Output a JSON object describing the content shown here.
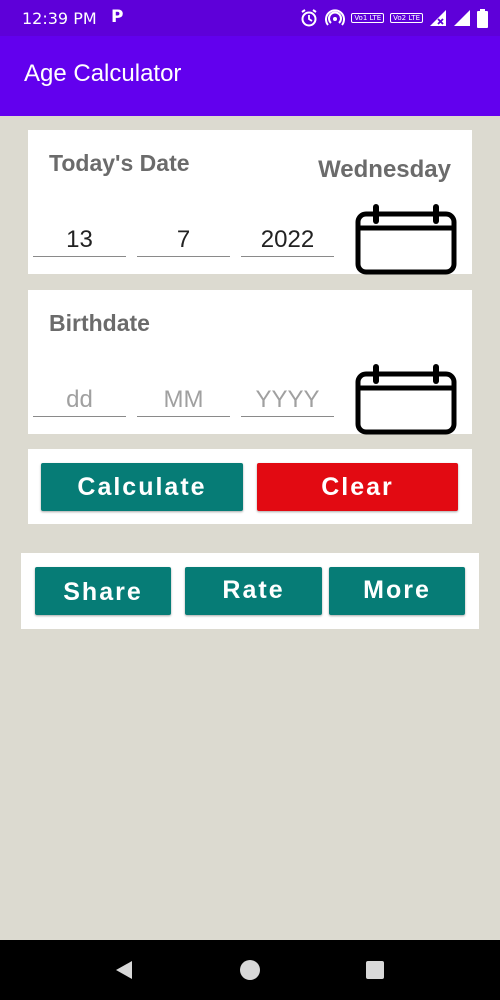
{
  "status_bar": {
    "time": "12:39 PM",
    "app_badge": "P",
    "icons": [
      "alarm-icon",
      "hotspot-icon",
      "volte-1-icon",
      "volte-2-icon",
      "signal-x-icon",
      "signal-icon",
      "battery-icon"
    ],
    "volte_sim1": "Vo1 LTE",
    "volte_sim2": "Vo2 LTE"
  },
  "app_bar": {
    "title": "Age Calculator",
    "color": "#6200ee"
  },
  "today": {
    "label": "Today's Date",
    "weekday": "Wednesday",
    "day": "13",
    "month": "7",
    "year": "2022",
    "picker_icon": "calendar-icon"
  },
  "birth": {
    "label": "Birthdate",
    "day_placeholder": "dd",
    "month_placeholder": "MM",
    "year_placeholder": "YYYY",
    "picker_icon": "calendar-icon"
  },
  "actions": {
    "calculate": "Calculate",
    "clear": "Clear",
    "calculate_color": "#067c76",
    "clear_color": "#e20a12"
  },
  "extra": {
    "share": "Share",
    "rate": "Rate",
    "more": "More"
  },
  "nav_bar": {
    "buttons": [
      "back-icon",
      "home-icon",
      "recents-icon"
    ]
  }
}
